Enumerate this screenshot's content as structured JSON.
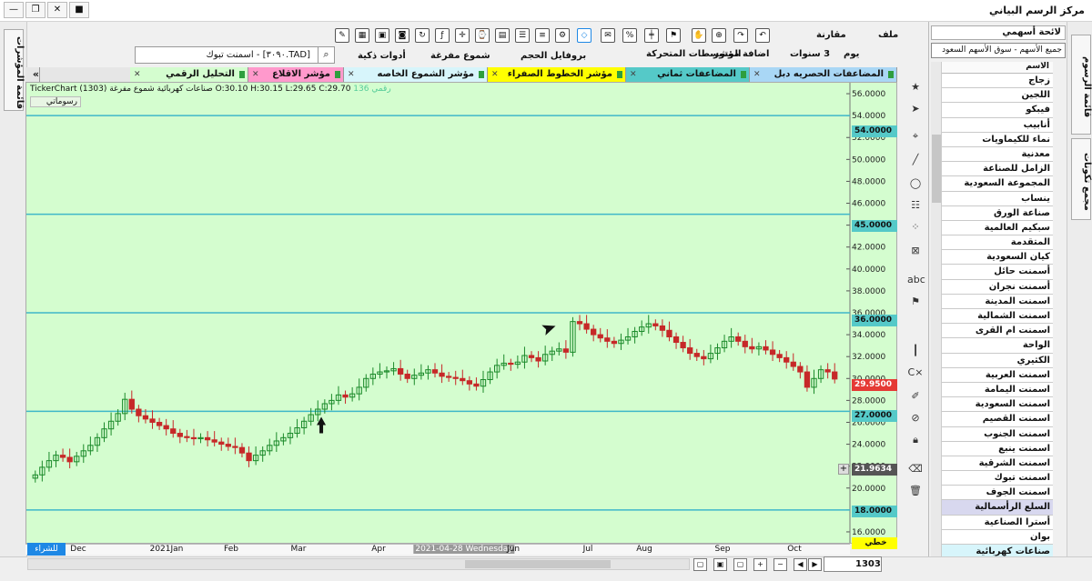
{
  "window": {
    "title": "مركز الرسم البياني",
    "minimize_icon": "minimize-icon",
    "restore_icon": "restore-icon",
    "camera_icon": "camera-icon"
  },
  "toolbar_top": {
    "file": "ملف",
    "compare": "مقارنة",
    "duration": "3 سنوات",
    "interval": "يوم",
    "add_indicator": "اضافة مؤشر",
    "moving_averages": "المتوسطات المتحركة"
  },
  "toolbar_second": {
    "volume_profile": "بروفايل الحجم",
    "hollow_candles": "شموع مفرغة",
    "smart_tools": "أدوات ذكية",
    "search_value": "[TAD.٣٠٩٠] - اسمنت تبوك"
  },
  "chart_tabs": [
    {
      "label": "المضاعفات الحصريه دبل",
      "color": "#a9d7f5"
    },
    {
      "label": "المضاعفات  ثماني",
      "color": "#55c9c8"
    },
    {
      "label": "مؤشر الخطوط الصفراء",
      "color": "#ffff00"
    },
    {
      "label": "مؤشر الشموع الخاصه",
      "color": "#d7f5fb"
    },
    {
      "label": "مؤشر الاقلاع",
      "color": "#ff99cc"
    },
    {
      "label": "التحليل الرقمي",
      "color": "#d4fdcf"
    }
  ],
  "chart_header": {
    "brand": "TickerChart",
    "info": "صناعات كهربائية شموع مفرغة (1303) O:30.10 H:30.15 L:29.65 C:29.70",
    "code": "رقمي 136",
    "pane_label": "رسوماتي"
  },
  "chart_data": {
    "type": "candlestick",
    "symbol": "1303",
    "x_ticks": [
      "Dec",
      "2021Jan",
      "Feb",
      "Mar",
      "Apr",
      "2021-04-28 Wednesday",
      "Jun",
      "Jul",
      "Aug",
      "Sep",
      "Oct"
    ],
    "y_ticks": [
      16,
      18,
      20,
      22,
      24,
      26,
      28,
      30,
      32,
      34,
      36,
      38,
      40,
      42,
      44,
      46,
      48,
      50,
      52,
      54,
      56
    ],
    "ylim": [
      15,
      57
    ],
    "horizontal_lines": [
      54,
      45,
      36,
      27,
      18
    ],
    "last_price": 29.95,
    "crosshair_price": 21.9634,
    "close_series": [
      21.2,
      21.9,
      22.5,
      23.0,
      22.8,
      22.4,
      22.9,
      23.4,
      23.9,
      24.6,
      25.4,
      26.1,
      26.8,
      28.1,
      27.2,
      26.6,
      26.3,
      26.0,
      25.7,
      25.4,
      25.0,
      24.7,
      24.6,
      24.5,
      24.6,
      24.4,
      24.2,
      24.0,
      23.8,
      23.7,
      23.2,
      22.5,
      23.0,
      23.4,
      23.9,
      24.3,
      24.6,
      25.0,
      25.5,
      26.1,
      26.7,
      27.2,
      27.7,
      28.0,
      28.5,
      28.3,
      28.6,
      29.2,
      30.0,
      30.4,
      30.6,
      30.7,
      30.9,
      30.4,
      30.0,
      30.3,
      30.5,
      30.8,
      30.5,
      30.2,
      30.1,
      30.0,
      29.8,
      29.5,
      29.3,
      29.9,
      30.6,
      31.2,
      31.4,
      31.3,
      31.5,
      32.1,
      31.9,
      31.6,
      32.2,
      32.5,
      32.7,
      32.4,
      35.2,
      35.0,
      34.5,
      34.0,
      33.7,
      33.4,
      33.2,
      33.5,
      33.8,
      34.3,
      34.7,
      35.0,
      34.8,
      34.4,
      33.8,
      33.3,
      32.8,
      32.3,
      32.0,
      31.8,
      32.3,
      32.8,
      33.4,
      33.8,
      33.4,
      32.9,
      32.7,
      32.9,
      32.6,
      32.2,
      31.9,
      31.5,
      31.1,
      30.6,
      29.2,
      30.0,
      30.8,
      30.6,
      29.95
    ],
    "annotations": [
      "arrow-up near Mar",
      "arrow near Jul"
    ]
  },
  "price_labels": {
    "p54": "54.0000",
    "p45": "45.0000",
    "p36": "36.0000",
    "p27": "27.0000",
    "p18": "18.0000",
    "last": "29.9500",
    "cross": "21.9634",
    "line_label": "خطي"
  },
  "right_panel": {
    "header": "لائحة أسهمي",
    "market_select": "جميع الأسهم - سوق الأسهم السعود",
    "column_header": "الاسم",
    "items": [
      "زجاج",
      "اللجين",
      "فيبكو",
      "أنابيب",
      "نماء للكيماويات",
      "معدنية",
      "الزامل للصناعة",
      "المجموعة السعودية",
      "ينساب",
      "صناعة الورق",
      "سبكيم العالمية",
      "المتقدمة",
      "كيان السعودية",
      "أسمنت حائل",
      "أسمنت نجران",
      "اسمنت المدينة",
      "اسمنت الشمالية",
      "اسمنت ام القرى",
      "الواحة",
      "الكثيري",
      "اسمنت العربية",
      "اسمنت اليمامة",
      "اسمنت السعودية",
      "اسمنت القصيم",
      "اسمنت الجنوب",
      "اسمنت ينبع",
      "اسمنت الشرقية",
      "اسمنت تبوك",
      "اسمنت الجوف",
      "السلع الرأسمالية",
      "أسترا الصناعية",
      "بوان",
      "صناعات كهربائية"
    ]
  },
  "side_tabs": {
    "left": "قائمة المؤشرات",
    "right_top": "قائمة الرسوم",
    "right_mid": "مجمع تكونات"
  },
  "bottom": {
    "bars_count": "1303",
    "draw_label": "للشراء"
  }
}
